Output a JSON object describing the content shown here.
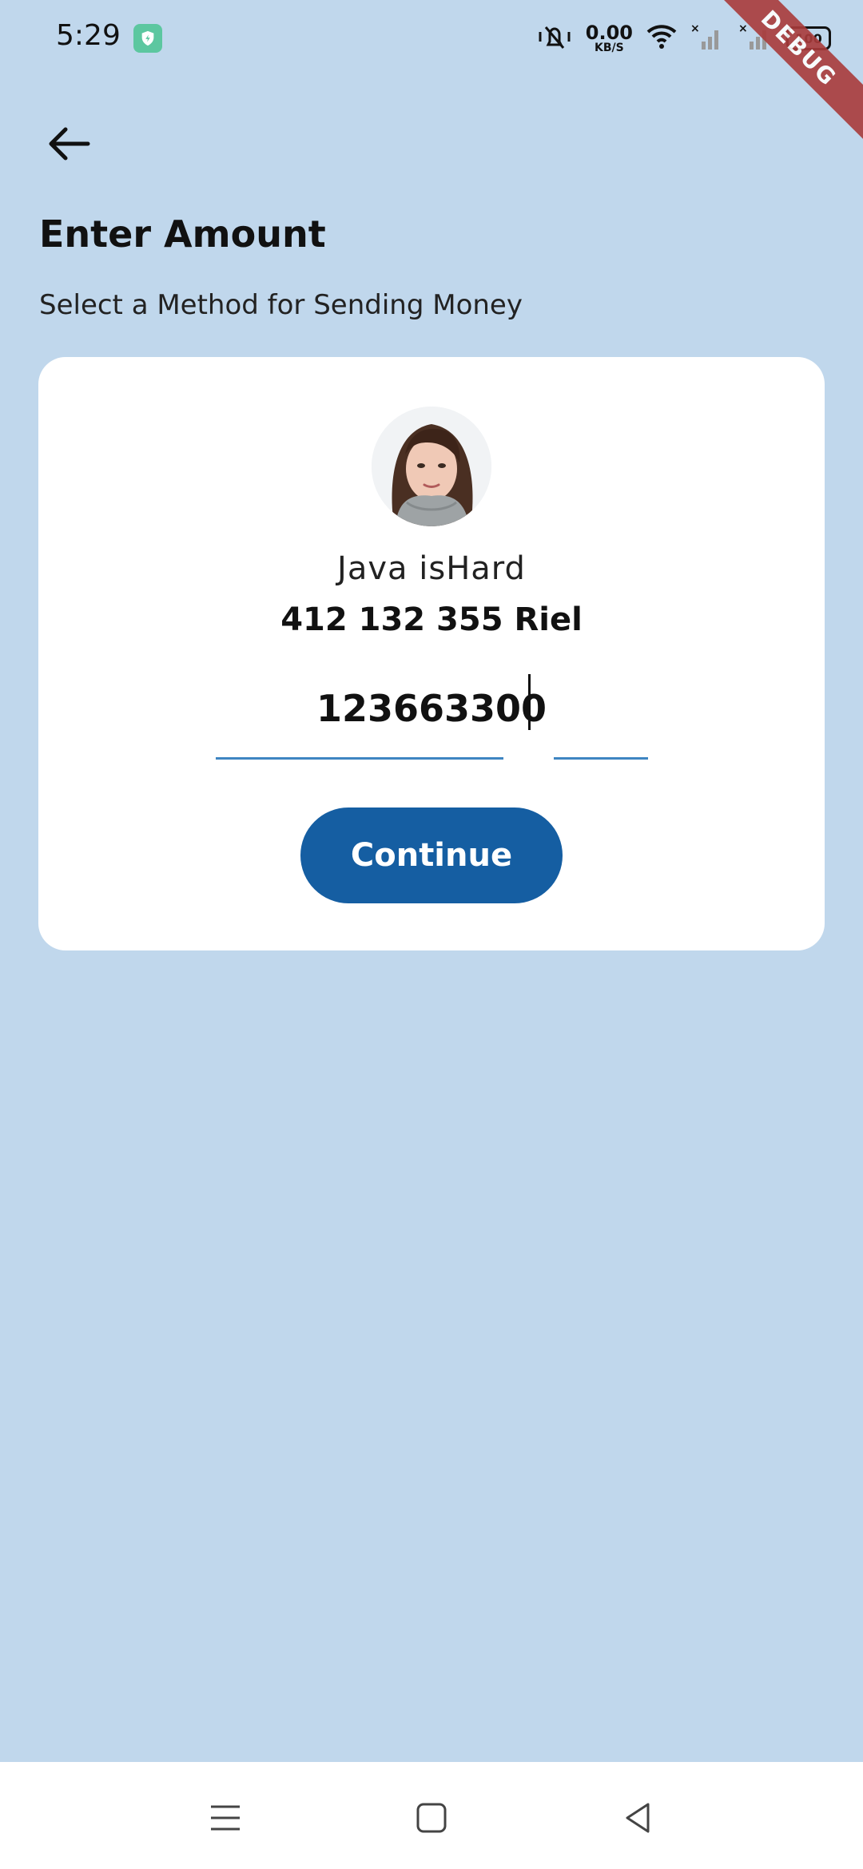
{
  "status_bar": {
    "time": "5:29",
    "net_speed_value": "0.00",
    "net_speed_unit": "KB/S",
    "battery": "100",
    "debug_label": "DEBUG"
  },
  "header": {
    "title": "Enter Amount",
    "subtitle": "Select a Method for Sending Money"
  },
  "card": {
    "recipient_name": "Java isHard",
    "account_number": "412 132 355 Riel",
    "amount_value": "123663300",
    "continue_label": "Continue"
  },
  "colors": {
    "background": "#c0d7ec",
    "primary_button": "#155ea2",
    "input_underline": "#3f85c2"
  },
  "icons": {
    "back": "arrow-left-icon",
    "menu": "menu-icon",
    "home": "home-square-icon",
    "back_nav": "back-triangle-icon"
  }
}
